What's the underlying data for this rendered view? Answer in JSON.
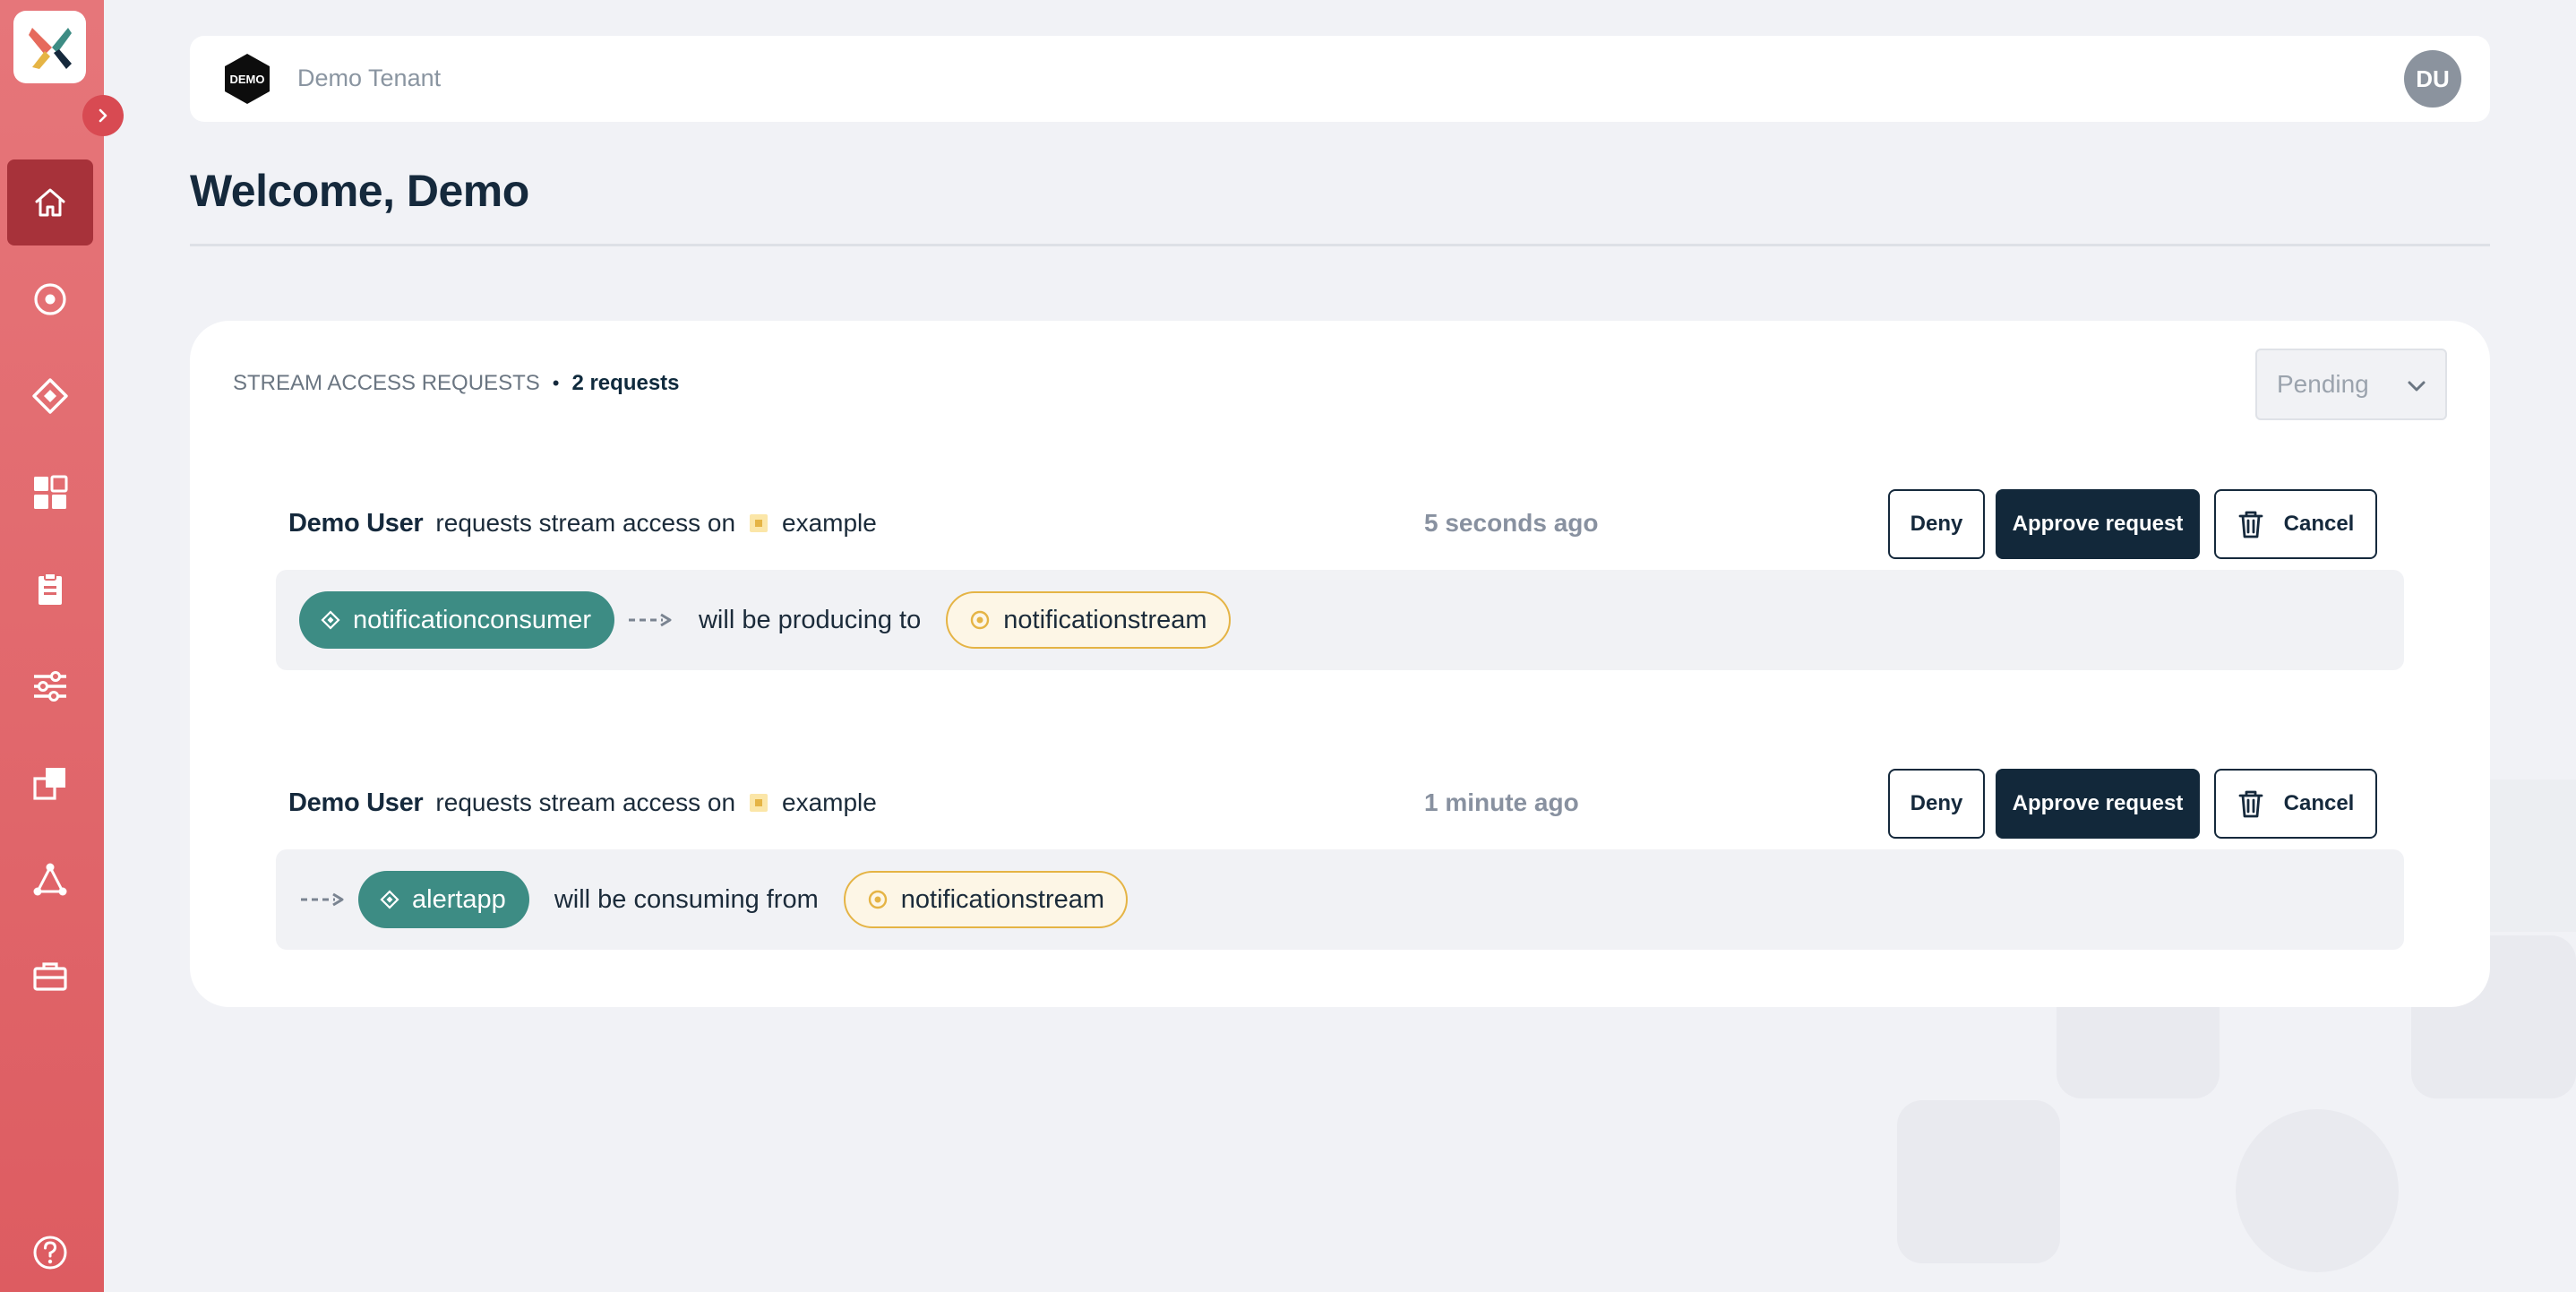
{
  "sidebar": {
    "nav": [
      {
        "name": "home-icon",
        "active": true
      },
      {
        "name": "stream-icon"
      },
      {
        "name": "application-icon"
      },
      {
        "name": "dashboard-icon"
      },
      {
        "name": "clipboard-icon"
      },
      {
        "name": "settings-sliders-icon"
      },
      {
        "name": "layers-icon"
      },
      {
        "name": "topology-icon"
      },
      {
        "name": "toolbox-icon"
      }
    ],
    "help": "help-icon"
  },
  "header": {
    "tenant_logo_text": "DEMO",
    "tenant_name": "Demo Tenant",
    "user_initials": "DU"
  },
  "page": {
    "title": "Welcome, Demo"
  },
  "panel": {
    "title": "STREAM ACCESS REQUESTS",
    "count_label": "2 requests",
    "status_filter": "Pending"
  },
  "requests": [
    {
      "user": "Demo User",
      "text": "requests stream access on",
      "application": "example",
      "time": "5 seconds ago",
      "direction": "producing",
      "app_name": "notificationconsumer",
      "flow_text": "will be producing to",
      "stream": "notificationstream"
    },
    {
      "user": "Demo User",
      "text": "requests stream access on",
      "application": "example",
      "time": "1 minute ago",
      "direction": "consuming",
      "app_name": "alertapp",
      "flow_text": "will be consuming from",
      "stream": "notificationstream"
    }
  ],
  "buttons": {
    "deny": "Deny",
    "approve": "Approve request",
    "cancel": "Cancel"
  },
  "colors": {
    "sidebar": "#dd5c61",
    "active_nav": "#a7323a",
    "primary": "#12283a",
    "app_pill": "#3d8c84",
    "stream_accent": "#e5b445"
  }
}
